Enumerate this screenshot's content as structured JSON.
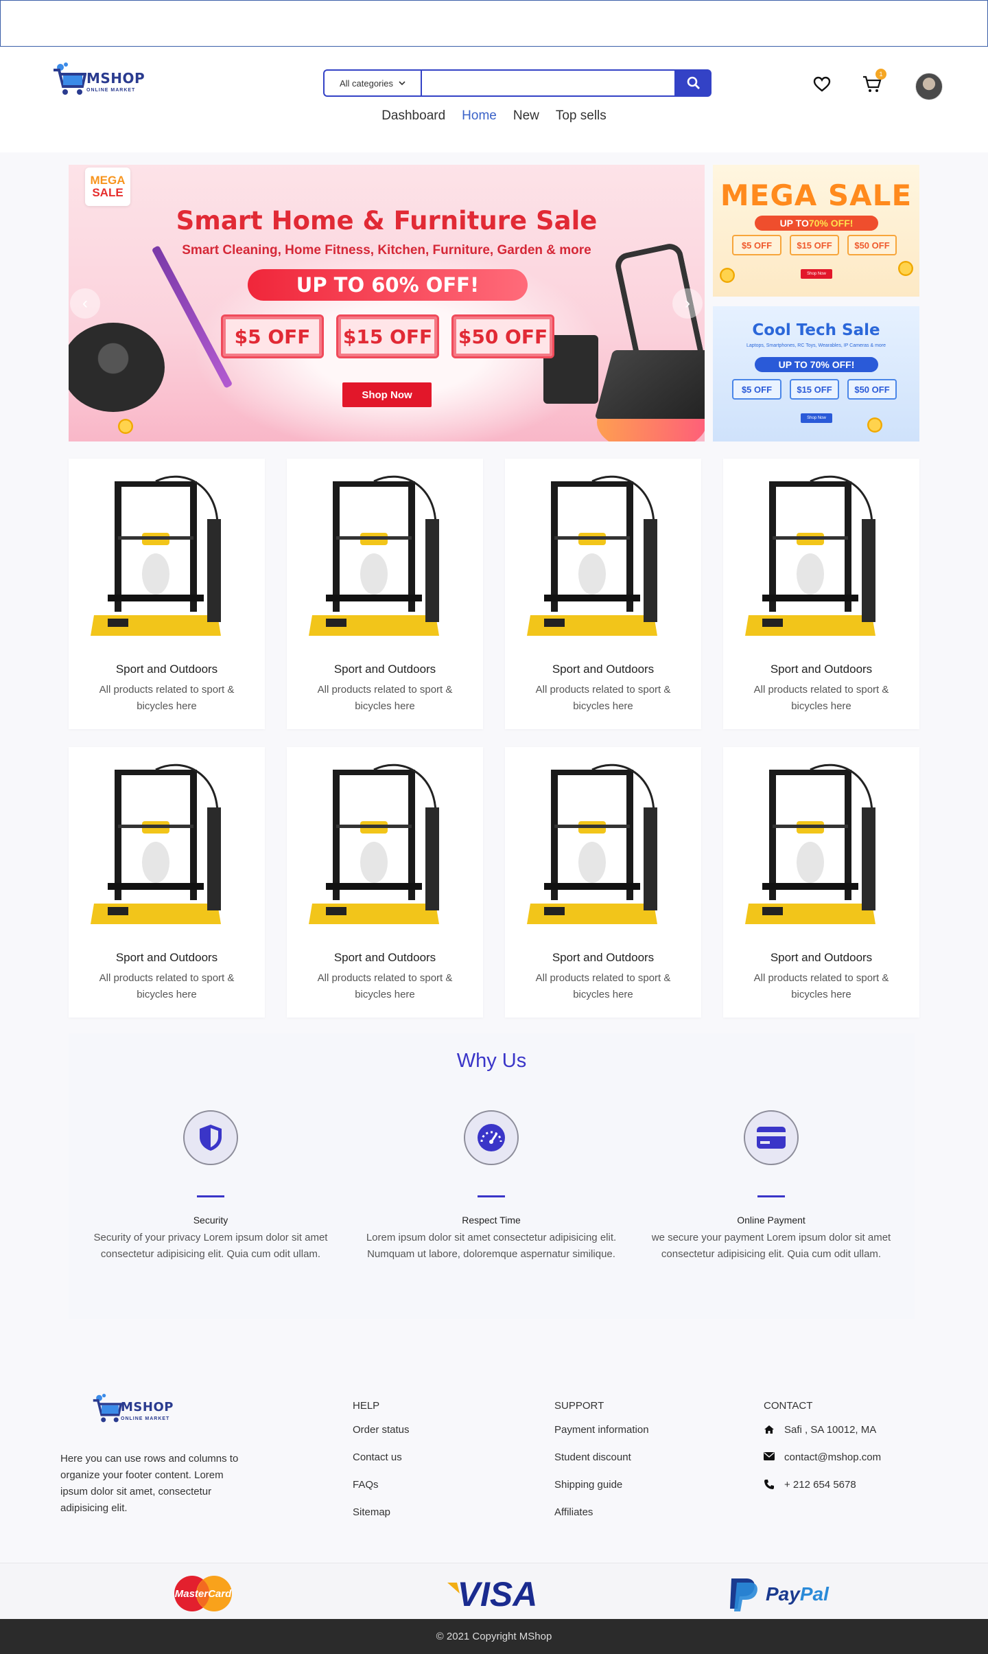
{
  "brand": {
    "name": "MSHOP",
    "tagline": "ONLINE MARKET"
  },
  "search": {
    "category": "All categories",
    "placeholder": "",
    "value": ""
  },
  "header": {
    "cart_count": "1"
  },
  "nav": {
    "items": [
      "Dashboard",
      "Home",
      "New",
      "Top sells"
    ],
    "active": "Home"
  },
  "hero": {
    "tag_top": "MEGA",
    "tag_bottom": "SALE",
    "title": "Smart Home & Furniture Sale",
    "subtitle": "Smart Cleaning, Home Fitness, Kitchen, Furniture, Garden & more",
    "upto": "UP TO 60% OFF!",
    "coupons": [
      "$5 OFF",
      "$15 OFF",
      "$50 OFF"
    ],
    "cta": "Shop Now",
    "prev": "‹",
    "next": "›"
  },
  "side_banners": [
    {
      "title": "MEGA SALE",
      "pill_prefix": "UP TO ",
      "pill_highlight": "70% OFF!",
      "coupons": [
        "$5 OFF",
        "$15 OFF",
        "$50 OFF"
      ],
      "cta": "Shop Now"
    },
    {
      "title": "Cool Tech Sale",
      "small": "Laptops, Smartphones, RC Toys, Wearables, IP Cameras & more",
      "pill": "UP TO 70% OFF!",
      "coupons": [
        "$5 OFF",
        "$15 OFF",
        "$50 OFF"
      ],
      "cta": "Shop Now"
    }
  ],
  "products": [
    {
      "title": "Sport and Outdoors",
      "desc": "All products related to sport & bicycles here"
    },
    {
      "title": "Sport and Outdoors",
      "desc": "All products related to sport & bicycles here"
    },
    {
      "title": "Sport and Outdoors",
      "desc": "All products related to sport & bicycles here"
    },
    {
      "title": "Sport and Outdoors",
      "desc": "All products related to sport & bicycles here"
    },
    {
      "title": "Sport and Outdoors",
      "desc": "All products related to sport & bicycles here"
    },
    {
      "title": "Sport and Outdoors",
      "desc": "All products related to sport & bicycles here"
    },
    {
      "title": "Sport and Outdoors",
      "desc": "All products related to sport & bicycles here"
    },
    {
      "title": "Sport and Outdoors",
      "desc": "All products related to sport & bicycles here"
    }
  ],
  "why": {
    "title": "Why Us",
    "items": [
      {
        "name": "Security",
        "desc": "Security of your privacy Lorem ipsum dolor sit amet consectetur adipisicing elit. Quia cum odit ullam.",
        "icon": "shield-icon"
      },
      {
        "name": "Respect Time",
        "desc": "Lorem ipsum dolor sit amet consectetur adipisicing elit. Numquam ut labore, doloremque aspernatur similique.",
        "icon": "speedometer-icon"
      },
      {
        "name": "Online Payment",
        "desc": "we secure your payment Lorem ipsum dolor sit amet consectetur adipisicing elit. Quia cum odit ullam.",
        "icon": "credit-card-icon"
      }
    ]
  },
  "footer": {
    "about": "Here you can use rows and columns to organize your footer content. Lorem ipsum dolor sit amet, consectetur adipisicing elit.",
    "help": {
      "title": "HELP",
      "items": [
        "Order status",
        "Contact us",
        "FAQs",
        "Sitemap"
      ]
    },
    "support": {
      "title": "SUPPORT",
      "items": [
        "Payment information",
        "Student discount",
        "Shipping guide",
        "Affiliates"
      ]
    },
    "contact": {
      "title": "CONTACT",
      "address": "Safi , SA 10012, MA",
      "email": "contact@mshop.com",
      "phone": "+ 212 654 5678"
    }
  },
  "payments": {
    "mastercard": "MasterCard",
    "visa": "VISA",
    "paypal_pay": "Pay",
    "paypal_pal": "Pal"
  },
  "copyright": "© 2021 Copyright MShop",
  "colors": {
    "accent": "#3342c6",
    "nav_active": "#3a62c8",
    "why_title": "#3a35c8",
    "badge": "#f5a623"
  }
}
